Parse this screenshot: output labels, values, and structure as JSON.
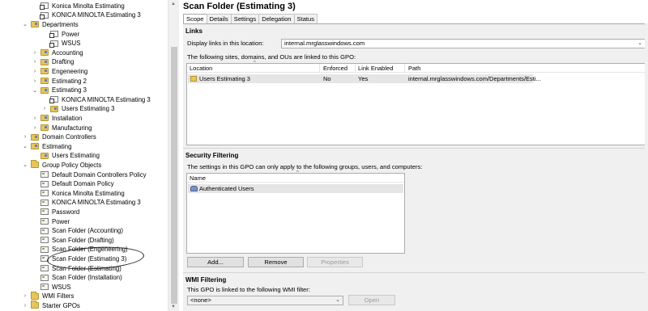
{
  "tree": {
    "items": [
      {
        "label": "Konica Minolta Estimating",
        "icon": "gpo-link-icon",
        "expander": ""
      },
      {
        "label": "KONICA MINOLTA Estimating 3",
        "icon": "gpo-link-icon",
        "expander": ""
      },
      {
        "label": "Departments",
        "icon": "ou-icon",
        "expander": "⌄"
      },
      {
        "label": "Power",
        "icon": "gpo-link-icon",
        "expander": ""
      },
      {
        "label": "WSUS",
        "icon": "gpo-link-icon",
        "expander": ""
      },
      {
        "label": "Accounting",
        "icon": "ou-icon",
        "expander": "›"
      },
      {
        "label": "Drafting",
        "icon": "ou-icon",
        "expander": "›"
      },
      {
        "label": "Engeneering",
        "icon": "ou-icon",
        "expander": "›"
      },
      {
        "label": "Estimating 2",
        "icon": "ou-icon",
        "expander": "›"
      },
      {
        "label": "Estimating 3",
        "icon": "ou-icon",
        "expander": "⌄"
      },
      {
        "label": "KONICA MINOLTA Estimating 3",
        "icon": "gpo-link-icon",
        "expander": ""
      },
      {
        "label": "Users Estimating 3",
        "icon": "ou-icon",
        "expander": "›"
      },
      {
        "label": "Installation",
        "icon": "ou-icon",
        "expander": "›"
      },
      {
        "label": "Manufacturing",
        "icon": "ou-icon",
        "expander": "›"
      },
      {
        "label": "Domain Controllers",
        "icon": "ou-icon",
        "expander": "›"
      },
      {
        "label": "Estimating",
        "icon": "ou-icon",
        "expander": "⌄"
      },
      {
        "label": "Users Estimating",
        "icon": "ou-icon",
        "expander": ""
      },
      {
        "label": "Group Policy Objects",
        "icon": "folder-icon",
        "expander": "⌄"
      },
      {
        "label": "Default Domain Controllers Policy",
        "icon": "gpo-icon",
        "expander": ""
      },
      {
        "label": "Default Domain Policy",
        "icon": "gpo-icon",
        "expander": ""
      },
      {
        "label": "Konica Minolta Estimating",
        "icon": "gpo-icon",
        "expander": ""
      },
      {
        "label": "KONICA MINOLTA Estimating 3",
        "icon": "gpo-icon",
        "expander": ""
      },
      {
        "label": "Password",
        "icon": "gpo-icon",
        "expander": ""
      },
      {
        "label": "Power",
        "icon": "gpo-icon",
        "expander": ""
      },
      {
        "label": "Scan Folder (Accounting)",
        "icon": "gpo-icon",
        "expander": ""
      },
      {
        "label": "Scan Folder (Drafting)",
        "icon": "gpo-icon",
        "expander": ""
      },
      {
        "label": "Scan Folder (Engeneering)",
        "icon": "gpo-icon",
        "expander": ""
      },
      {
        "label": "Scan Folder (Estimating 3)",
        "icon": "gpo-icon",
        "expander": ""
      },
      {
        "label": "Scan Folder (Estimating)",
        "icon": "gpo-icon",
        "expander": ""
      },
      {
        "label": "Scan Folder (Installation)",
        "icon": "gpo-icon",
        "expander": ""
      },
      {
        "label": "WSUS",
        "icon": "gpo-icon",
        "expander": ""
      },
      {
        "label": "WMI Filters",
        "icon": "folder-icon",
        "expander": "›"
      },
      {
        "label": "Starter GPOs",
        "icon": "folder-icon",
        "expander": "›"
      }
    ]
  },
  "header": {
    "title": "Scan Folder (Estimating 3)",
    "tabs": [
      {
        "label": "Scope",
        "active": true
      },
      {
        "label": "Details",
        "active": false
      },
      {
        "label": "Settings",
        "active": false
      },
      {
        "label": "Delegation",
        "active": false
      },
      {
        "label": "Status",
        "active": false
      }
    ]
  },
  "links": {
    "title": "Links",
    "display_label": "Display links in this location:",
    "location_value": "internal.mrglasswindows.com",
    "description": "The following sites, domains, and OUs are linked to this GPO:",
    "columns": [
      "Location",
      "Enforced",
      "Link Enabled",
      "Path"
    ],
    "rows": [
      {
        "location": "Users Estimating 3",
        "enforced": "No",
        "link_enabled": "Yes",
        "path": "internal.mrglasswindows.com/Departments/Esti..."
      }
    ]
  },
  "security": {
    "title": "Security Filtering",
    "description": "The settings in this GPO can only apply to the following groups, users, and computers:",
    "columns": [
      "Name"
    ],
    "rows": [
      {
        "name": "Authenticated Users"
      }
    ],
    "add_label": "Add...",
    "remove_label": "Remove",
    "properties_label": "Properties"
  },
  "wmi": {
    "title": "WMI Filtering",
    "description": "This GPO is linked to the following WMI filter:",
    "filter_value": "<none>",
    "open_label": "Open"
  },
  "colors": {
    "panel": "#f0f0f0",
    "selected_row": "#e5e5e5",
    "border": "#adadad"
  }
}
